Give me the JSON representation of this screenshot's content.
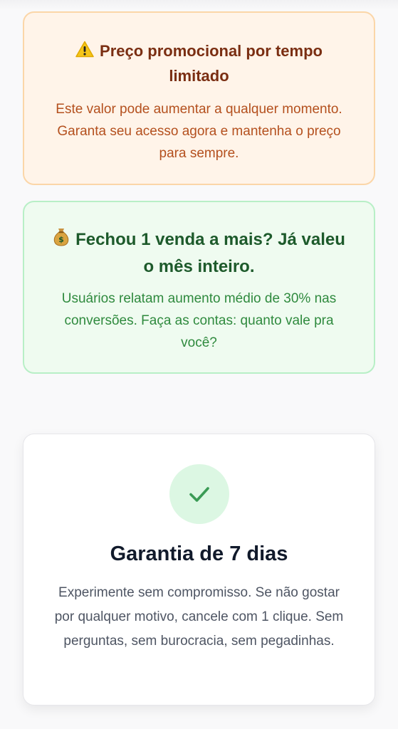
{
  "warning_card": {
    "icon": "warning-icon",
    "title": "Preço promocional por tempo limitado",
    "text": "Este valor pode aumentar a qualquer momento. Garanta seu acesso agora e mantenha o preço para sempre.",
    "colors": {
      "background": "#fff4e9",
      "border": "#fbd6a8",
      "title": "#7a2e12",
      "text": "#b4501e"
    }
  },
  "money_card": {
    "icon": "money-bag-icon",
    "title": "Fechou 1 venda a mais? Já valeu o mês inteiro.",
    "text": "Usuários relatam aumento médio de 30% nas conversões. Faça as contas: quanto vale pra você?",
    "colors": {
      "background": "#effbf0",
      "border": "#b8efc6",
      "title": "#1d5a2b",
      "text": "#2f8a3e"
    }
  },
  "guarantee_card": {
    "icon": "check-icon",
    "title": "Garantia de 7 dias",
    "text": "Experimente sem compromisso. Se não gostar por qualquer motivo, cancele com 1 clique. Sem perguntas, sem burocracia, sem pegadinhas.",
    "colors": {
      "accent": "#3a9b55",
      "title": "#111a2b",
      "text": "#4e5563"
    }
  }
}
